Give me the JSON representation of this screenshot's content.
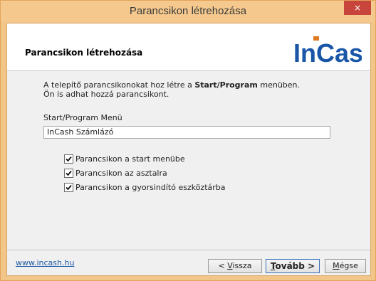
{
  "window": {
    "title": "Parancsikon létrehozása",
    "close_glyph": "×"
  },
  "header": {
    "title": "Parancsikon létrehozása",
    "logo_text": "InCash",
    "logo_color": "#1a56a8",
    "logo_accent": "#e07a1f"
  },
  "description": {
    "line1_prefix": "A telepítő parancsikonokat hoz létre a ",
    "line1_bold": "Start/Program",
    "line1_suffix": " menüben.",
    "line2": "Ön is adhat hozzá parancsikont."
  },
  "start_menu": {
    "label": "Start/Program Menü",
    "value": "InCash Számlázó"
  },
  "checkboxes": [
    {
      "label": "Parancsikon a start menübe",
      "checked": true
    },
    {
      "label": "Parancsikon az asztalra",
      "checked": true
    },
    {
      "label": "Parancsikon a gyorsindító eszköztárba",
      "checked": true
    }
  ],
  "footer": {
    "link": "www.incash.hu",
    "back_label_underlined": "V",
    "back_label_pre": "< ",
    "back_label_post": "issza",
    "next_label_underlined": "T",
    "next_label_post": "ovább >",
    "cancel_label_underlined": "M",
    "cancel_label_post": "égse"
  }
}
